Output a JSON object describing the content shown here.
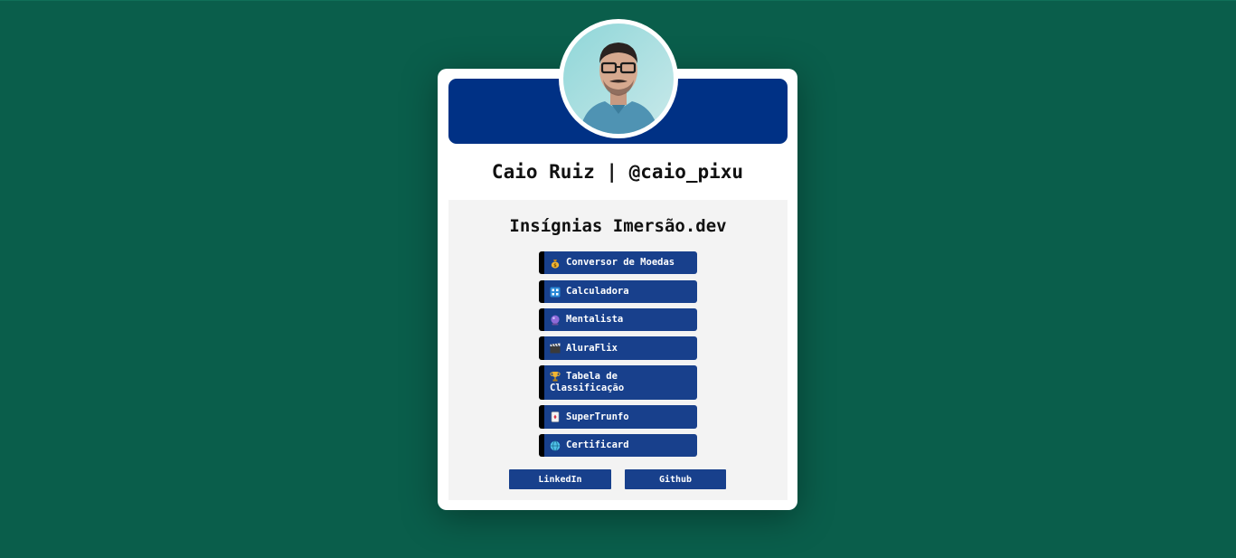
{
  "profile": {
    "name": "Caio Ruiz | @caio_pixu",
    "avatar_icon": "profile-photo"
  },
  "badges_section": {
    "title": "Insígnias Imersão.dev",
    "items": [
      {
        "label": "Conversor de Moedas",
        "icon": "money-bag-icon"
      },
      {
        "label": "Calculadora",
        "icon": "calculator-icon"
      },
      {
        "label": "Mentalista",
        "icon": "crystal-ball-icon"
      },
      {
        "label": "AluraFlix",
        "icon": "clapper-board-icon"
      },
      {
        "label_line1": "Tabela de",
        "label_line2": "Classificação",
        "icon": "trophy-icon"
      },
      {
        "label": "SuperTrunfo",
        "icon": "playing-card-icon"
      },
      {
        "label": "Certificard",
        "icon": "globe-icon"
      }
    ]
  },
  "links": {
    "linkedin": "LinkedIn",
    "github": "Github"
  },
  "colors": {
    "background": "#0a5e4b",
    "banner": "#003185",
    "badge": "#18408c",
    "panel": "#f3f3f3"
  }
}
